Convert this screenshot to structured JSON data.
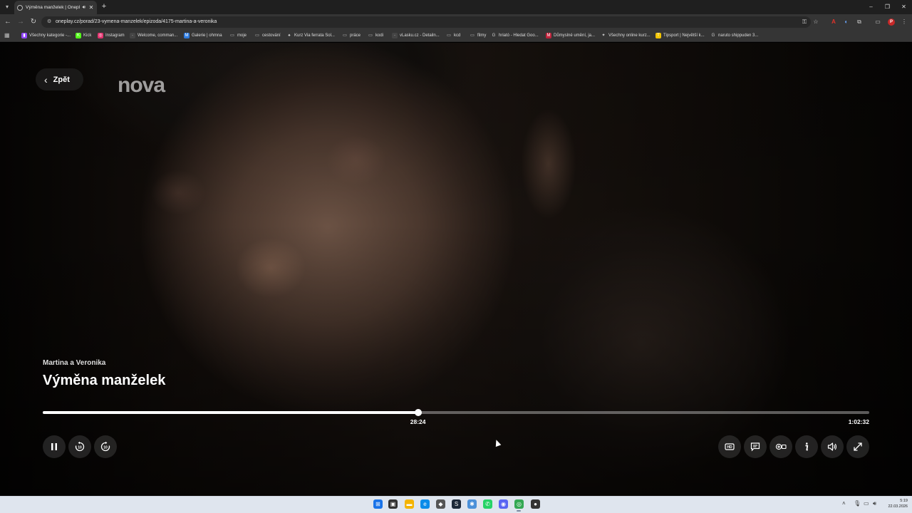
{
  "browser": {
    "tab_title": "Výměna manželek | Onepl...",
    "url": "oneplay.cz/porad/23-vymena-manzelek/epizoda/4175-martina-a-veronika",
    "profile_initial": "P",
    "bookmarks": [
      {
        "label": "Všechny kategorie -...",
        "icon": "twitch-icon",
        "color": "#9146ff",
        "glyph": "▮"
      },
      {
        "label": "Kick",
        "icon": "kick-icon",
        "color": "#53fc18",
        "glyph": "K"
      },
      {
        "label": "Instagram",
        "icon": "instagram-icon",
        "color": "#e1306c",
        "glyph": "◎"
      },
      {
        "label": "Welcome, comman...",
        "icon": "page-icon",
        "color": "#444",
        "glyph": "·"
      },
      {
        "label": "Galerie | ohmna",
        "icon": "gallery-icon",
        "color": "#2d7be0",
        "glyph": "M"
      },
      {
        "label": "moje",
        "icon": "folder-icon",
        "color": "transparent",
        "glyph": "▭"
      },
      {
        "label": "cestování",
        "icon": "folder-icon",
        "color": "transparent",
        "glyph": "▭"
      },
      {
        "label": "Kurz Via ferrata Sol...",
        "icon": "mountain-icon",
        "color": "transparent",
        "glyph": "♠"
      },
      {
        "label": "práce",
        "icon": "folder-icon",
        "color": "transparent",
        "glyph": "▭"
      },
      {
        "label": "kodi",
        "icon": "folder-icon",
        "color": "transparent",
        "glyph": "▭"
      },
      {
        "label": "vLasku.cz - Detailn...",
        "icon": "page-icon",
        "color": "#444",
        "glyph": "·"
      },
      {
        "label": "kcd",
        "icon": "folder-icon",
        "color": "transparent",
        "glyph": "▭"
      },
      {
        "label": "filmy",
        "icon": "folder-icon",
        "color": "transparent",
        "glyph": "▭"
      },
      {
        "label": "hriató - Hledat Goo...",
        "icon": "google-icon",
        "color": "transparent",
        "glyph": "G"
      },
      {
        "label": "Důmyslné umění, ja...",
        "icon": "m-icon",
        "color": "#c0223b",
        "glyph": "M"
      },
      {
        "label": "Všechny online kurz...",
        "icon": "course-icon",
        "color": "transparent",
        "glyph": "✦"
      },
      {
        "label": "Tipsport | Největší k...",
        "icon": "tipsport-icon",
        "color": "#f2c400",
        "glyph": "T"
      },
      {
        "label": "naruto shippuden 3...",
        "icon": "google-icon",
        "color": "transparent",
        "glyph": "G"
      }
    ]
  },
  "player": {
    "back_label": "Zpět",
    "logo_text": "nova",
    "episode_title": "Martina a Veronika",
    "show_title": "Výměna manželek",
    "current_time": "28:24",
    "total_time": "1:02:32",
    "progress": 0.454,
    "controls_left": [
      "pause-icon",
      "rewind-10-icon",
      "forward-10-icon"
    ],
    "controls_right": [
      "hd-icon",
      "subtitles-icon",
      "add-to-list-icon",
      "info-icon",
      "volume-icon",
      "fullscreen-icon"
    ],
    "hd_label": "HD"
  },
  "taskbar": {
    "time": "5:19",
    "date": "22.03.2026",
    "apps": [
      {
        "name": "start-icon",
        "color": "#1a73e8",
        "glyph": "⊞"
      },
      {
        "name": "task-view-icon",
        "color": "#333",
        "glyph": "▣"
      },
      {
        "name": "file-explorer-icon",
        "color": "#f4b400",
        "glyph": "▬"
      },
      {
        "name": "edge-icon",
        "color": "#0c8ce9",
        "glyph": "e"
      },
      {
        "name": "app-icon",
        "color": "#555",
        "glyph": "◆"
      },
      {
        "name": "steam-icon",
        "color": "#1b2838",
        "glyph": "S"
      },
      {
        "name": "app-icon",
        "color": "#4a90d9",
        "glyph": "✱"
      },
      {
        "name": "whatsapp-icon",
        "color": "#25d366",
        "glyph": "✆"
      },
      {
        "name": "discord-icon",
        "color": "#5865f2",
        "glyph": "◉"
      },
      {
        "name": "chrome-icon",
        "color": "#34a853",
        "glyph": "◎"
      },
      {
        "name": "app-icon",
        "color": "#333",
        "glyph": "●"
      }
    ]
  }
}
